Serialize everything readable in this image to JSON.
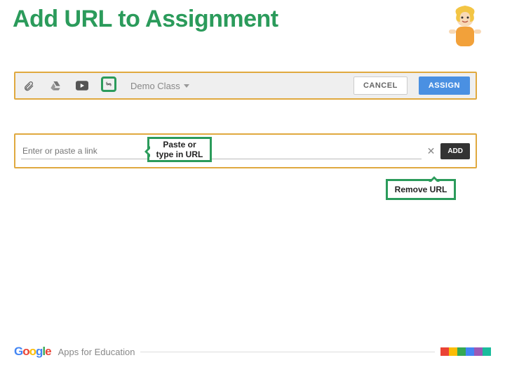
{
  "title": "Add URL to Assignment",
  "toolbar": {
    "class_label": "Demo Class",
    "cancel": "CANCEL",
    "assign": "ASSIGN"
  },
  "url": {
    "placeholder": "Enter or paste a link",
    "add": "ADD"
  },
  "callouts": {
    "paste": "Paste or type in URL",
    "remove": "Remove URL"
  },
  "footer": {
    "brand": "Google",
    "product": "Apps for Education"
  }
}
